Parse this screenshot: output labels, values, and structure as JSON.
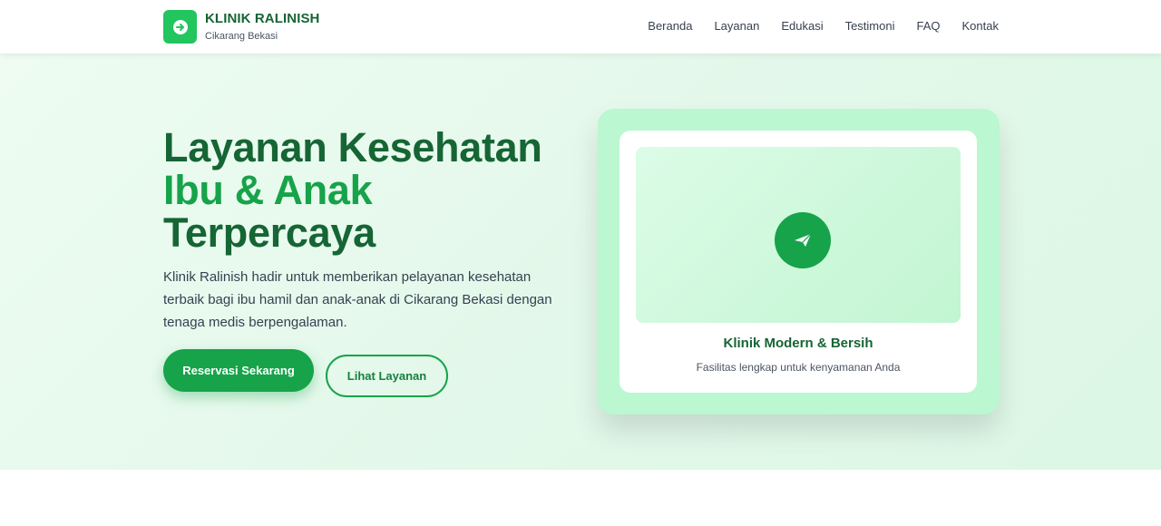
{
  "brand": {
    "name": "KLINIK RALINISH",
    "location": "Cikarang Bekasi",
    "logo_icon": "arrow-circle-icon"
  },
  "nav": {
    "items": [
      {
        "label": "Beranda"
      },
      {
        "label": "Layanan"
      },
      {
        "label": "Edukasi"
      },
      {
        "label": "Testimoni"
      },
      {
        "label": "FAQ"
      },
      {
        "label": "Kontak"
      }
    ]
  },
  "hero": {
    "title_line1": "Layanan Kesehatan",
    "title_line2": "Ibu & Anak",
    "title_line3": "Terpercaya",
    "description": "Klinik Ralinish hadir untuk memberikan pelayanan kesehatan terbaik bagi ibu hamil dan anak-anak di Cikarang Bekasi dengan tenaga medis berpengalaman.",
    "primary_button": "Reservasi Sekarang",
    "secondary_button": "Lihat Layanan"
  },
  "card": {
    "icon": "paper-plane-icon",
    "title": "Klinik Modern & Bersih",
    "subtitle": "Fasilitas lengkap untuk kenyamanan Anda"
  },
  "colors": {
    "brand_dark": "#166534",
    "brand": "#16a34a",
    "brand_light": "#22c55e",
    "hero_bg": "#e3f8ea",
    "card_bg": "#bbf7d0"
  }
}
